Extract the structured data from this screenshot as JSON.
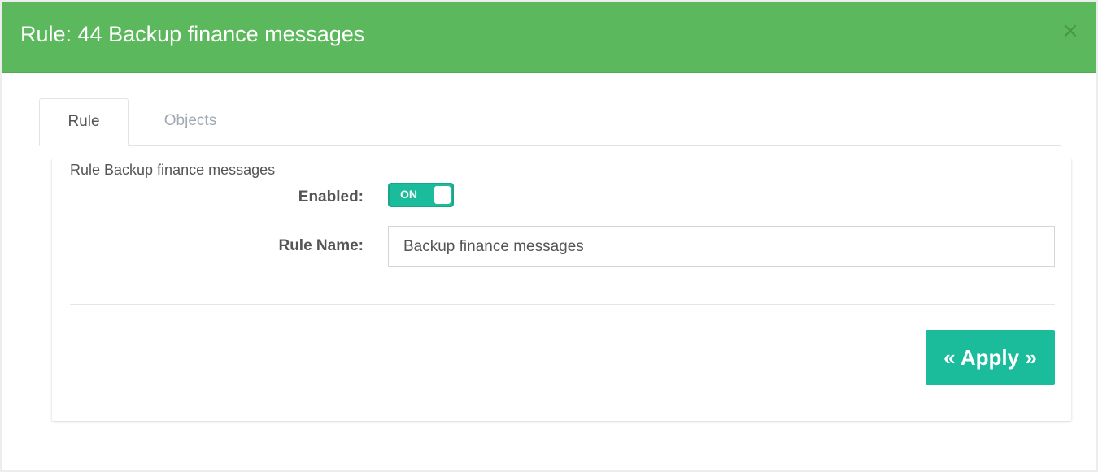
{
  "modal": {
    "title": "Rule: 44 Backup finance messages",
    "close_label": "×"
  },
  "tabs": [
    {
      "label": "Rule",
      "active": true
    },
    {
      "label": "Objects",
      "active": false
    }
  ],
  "panel": {
    "heading": "Rule Backup finance messages",
    "enabled_label": "Enabled:",
    "toggle_state": "ON",
    "rule_name_label": "Rule Name:",
    "rule_name_value": "Backup finance messages",
    "apply_label": "« Apply »"
  },
  "colors": {
    "header_green": "#5cb85c",
    "accent_teal": "#1abc9c"
  }
}
